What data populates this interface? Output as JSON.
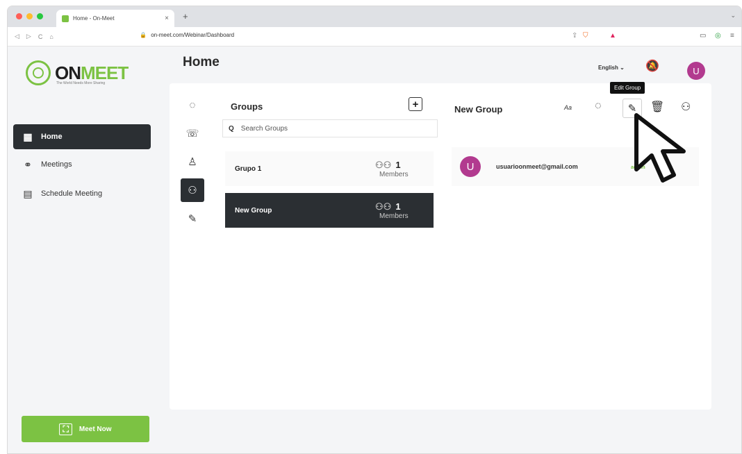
{
  "browser": {
    "tab_title": "Home - On-Meet",
    "tab_close": "×",
    "new_tab": "+",
    "url": "on-meet.com/Webinar/Dashboard",
    "nav": [
      "◁",
      "▷",
      "C",
      "⌂"
    ],
    "menu_icon": "⌄"
  },
  "brand": {
    "on": "ON",
    "meet": "MEET",
    "tagline": "The World Needs More Sharing",
    "accent_color": "#7cc243"
  },
  "sidebar": {
    "items": [
      {
        "label": "Home",
        "icon": "home-icon",
        "glyph": "▦",
        "active": true
      },
      {
        "label": "Meetings",
        "icon": "link-icon",
        "glyph": "⚭",
        "active": false
      },
      {
        "label": "Schedule Meeting",
        "icon": "calendar-icon",
        "glyph": "▤",
        "active": false
      }
    ],
    "meet_now_label": "Meet Now",
    "meet_now_glyph": "⛶"
  },
  "header": {
    "title": "Home",
    "language": "English ⌄",
    "bell_glyph": "🔕",
    "avatar_initial": "U"
  },
  "rail": {
    "items": [
      {
        "icon": "chat-icon",
        "glyph": "◌"
      },
      {
        "icon": "phone-icon",
        "glyph": "☏"
      },
      {
        "icon": "contact-icon",
        "glyph": "♙"
      },
      {
        "icon": "groups-icon",
        "glyph": "⚇",
        "active": true
      },
      {
        "icon": "wrench-icon",
        "glyph": "✎"
      }
    ]
  },
  "groups": {
    "title": "Groups",
    "add_glyph": "+",
    "search_placeholder": "Search Groups",
    "search_glyph": "Q",
    "list": [
      {
        "name": "Grupo 1",
        "count": "1",
        "members_label": "Members",
        "glyph": "⚇⚇",
        "active": false
      },
      {
        "name": "New Group",
        "count": "1",
        "members_label": "Members",
        "glyph": "⚇⚇",
        "active": true
      }
    ]
  },
  "detail": {
    "title": "New Group",
    "tooltip": "Edit Group",
    "actions": {
      "rename_glyph": "Aa",
      "chat_glyph": "◌",
      "edit_glyph": "✎",
      "delete_glyph": "🗑",
      "members_glyph": "⚇"
    },
    "member": {
      "initial": "U",
      "email": "usuarioonmeet@gmail.com",
      "role": "admin"
    }
  }
}
